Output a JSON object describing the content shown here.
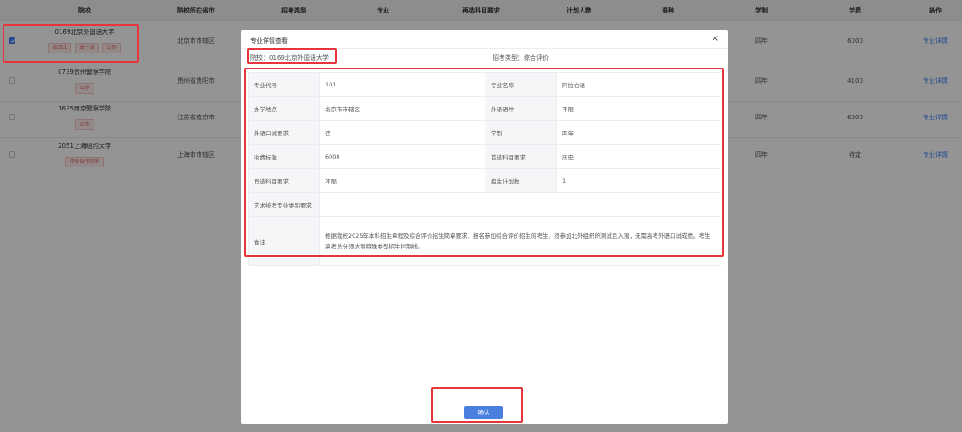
{
  "table": {
    "headers": [
      "院校",
      "院校所在省市",
      "招考类型",
      "专业",
      "再选科目要求",
      "计划人数",
      "语种",
      "学制",
      "学费",
      "操作"
    ],
    "rows": [
      {
        "checked": true,
        "school": "0169北京外国语大学",
        "tags": [
          "双211",
          "双一流",
          "公办"
        ],
        "city": "北京市市辖区",
        "years": "四年",
        "fee": "6000",
        "action": "专业详情"
      },
      {
        "checked": false,
        "school": "0739贵州警察学院",
        "tags": [
          "公办"
        ],
        "city": "贵州省贵阳市",
        "years": "四年",
        "fee": "4100",
        "action": "专业详情"
      },
      {
        "checked": false,
        "school": "1635南京警察学院",
        "tags": [
          "公办"
        ],
        "city": "江苏省南京市",
        "years": "四年",
        "fee": "6000",
        "action": "专业详情"
      },
      {
        "checked": false,
        "school": "2051上海纽约大学",
        "tags": [
          "中外合作办学"
        ],
        "city": "上海市市辖区",
        "years": "四年",
        "fee": "待定",
        "action": "专业详情"
      }
    ]
  },
  "modal": {
    "title": "专业详情查看",
    "close": "×",
    "school_line": "院校：0169北京外国语大学",
    "type_line": "招考类型：综合评价",
    "details": [
      {
        "k1": "专业代号",
        "v1": "101",
        "k2": "专业名称",
        "v2": "阿拉伯语"
      },
      {
        "k1": "办学地点",
        "v1": "北京市市辖区",
        "k2": "外语语种",
        "v2": "不限"
      },
      {
        "k1": "外语口试要求",
        "v1": "否",
        "k2": "学制",
        "v2": "四年"
      },
      {
        "k1": "收费标准",
        "v1": "6000",
        "k2": "首选科目要求",
        "v2": "历史"
      },
      {
        "k1": "再选科目要求",
        "v1": "不限",
        "k2": "招生计划数",
        "v2": "1"
      }
    ],
    "art_label": "艺术统考专业类别要求",
    "art_value": "",
    "note_label": "备注",
    "note_value": "根据我校2025年本科招生章程及综合评价招生简章要求，报名参加综合评价招生的考生，须参加北外组织的测试且入围，无需高考外语口试成绩。考生高考总分须达到特殊类型招生控制线。",
    "confirm": "确认"
  },
  "colors": {
    "accent": "#4a7fe0",
    "annotation": "#e8353b",
    "tag": "#e0555a"
  }
}
